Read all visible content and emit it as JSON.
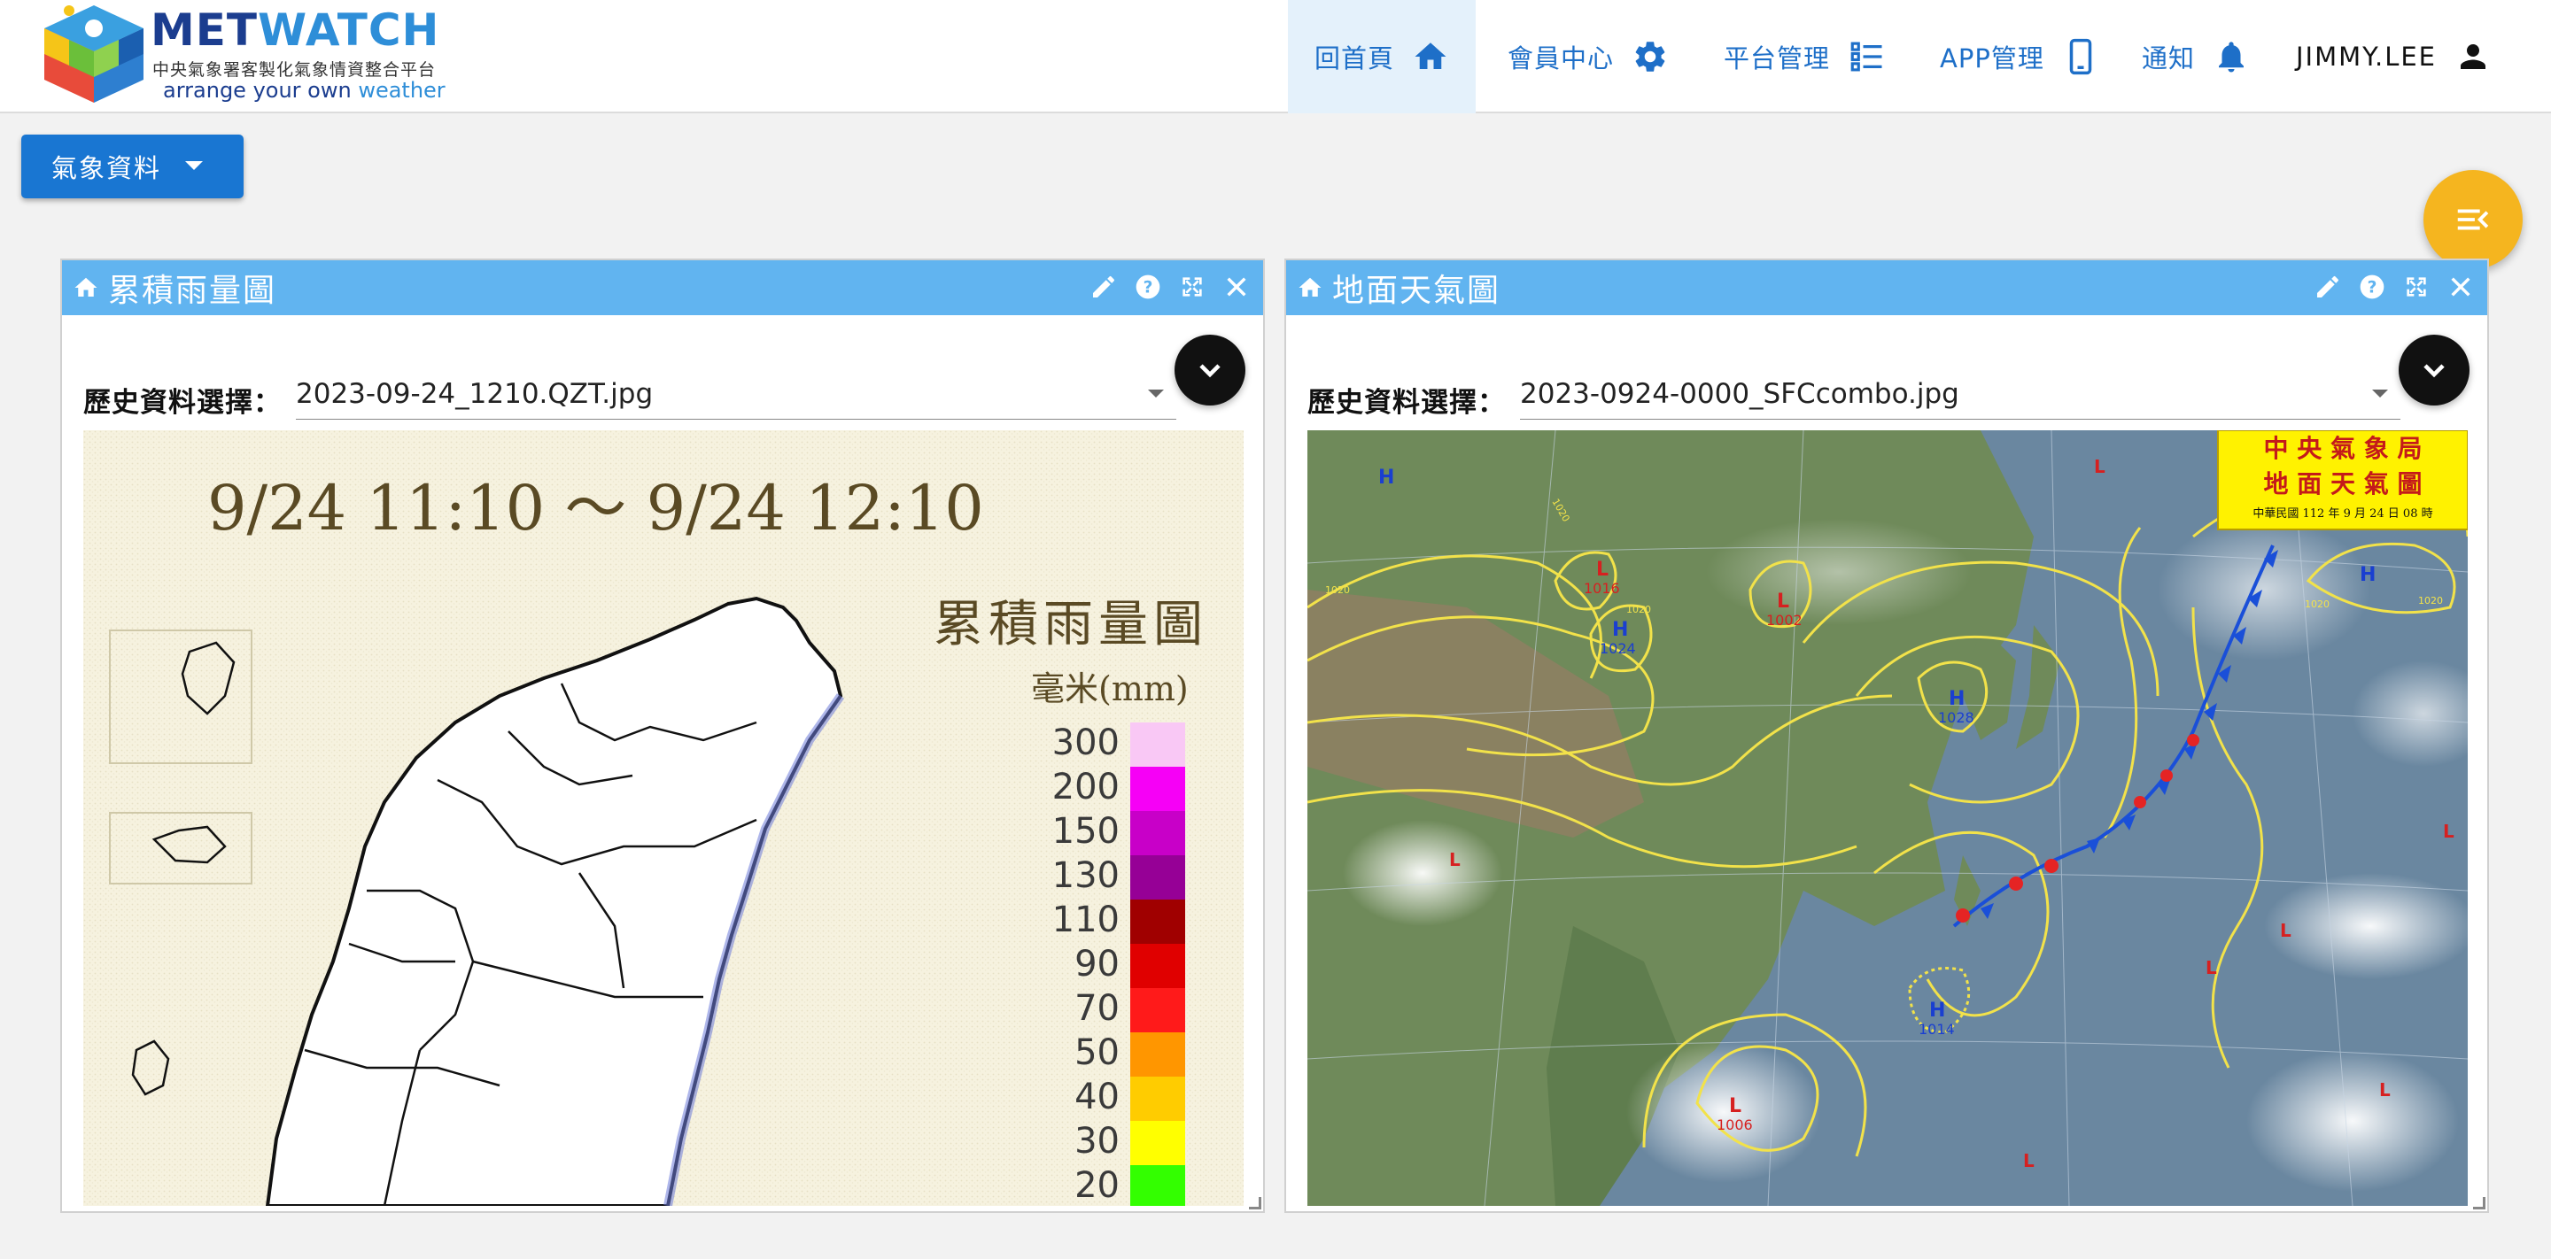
{
  "app": {
    "brand_met": "MET",
    "brand_watch": "WATCH",
    "subtitle": "中央氣象署客製化氣象情資整合平台",
    "tagline_start": "arrange your own ",
    "tagline_end": "weather"
  },
  "nav": {
    "home": "回首頁",
    "member": "會員中心",
    "platform": "平台管理",
    "app": "APP管理",
    "notify": "通知",
    "user": "JIMMY.LEE"
  },
  "toolbar": {
    "dropdown_label": "氣象資料"
  },
  "panels": {
    "left": {
      "title": "累積雨量圖",
      "select_label": "歷史資料選擇：",
      "select_value": "2023-09-24_1210.QZT.jpg",
      "map": {
        "time_range": "9/24 11:10 ～ 9/24 12:10",
        "heading": "累積雨量圖",
        "unit": "毫米(mm)",
        "legend": [
          {
            "value": "300",
            "color": "#f9c8f5"
          },
          {
            "value": "200",
            "color": "#f600f6"
          },
          {
            "value": "150",
            "color": "#c800c8"
          },
          {
            "value": "130",
            "color": "#960096"
          },
          {
            "value": "110",
            "color": "#a00000"
          },
          {
            "value": "90",
            "color": "#e00000"
          },
          {
            "value": "70",
            "color": "#ff1a1a"
          },
          {
            "value": "50",
            "color": "#ff9600"
          },
          {
            "value": "40",
            "color": "#ffcc00"
          },
          {
            "value": "30",
            "color": "#ffff00"
          },
          {
            "value": "20",
            "color": "#33ff00"
          }
        ]
      }
    },
    "right": {
      "title": "地面天氣圖",
      "select_label": "歷史資料選擇：",
      "select_value": "2023-0924-0000_SFCcombo.jpg",
      "map": {
        "stamp_line1": "中 央 氣 象 局",
        "stamp_line2": "地 面 天 氣 圖",
        "stamp_line3": "中華民國 112 年 9 月 24 日 08 時",
        "highs": [
          {
            "label": "H",
            "value": ""
          },
          {
            "label": "H",
            "value": "1024"
          },
          {
            "label": "H",
            "value": "1028"
          },
          {
            "label": "H",
            "value": "1014"
          },
          {
            "label": "H",
            "value": ""
          }
        ],
        "lows": [
          {
            "label": "L",
            "value": "1016"
          },
          {
            "label": "L",
            "value": "1002"
          },
          {
            "label": "L",
            "value": "1006"
          }
        ],
        "isobar_labels": [
          "1020",
          "1020",
          "1020",
          "1020",
          "1020"
        ]
      }
    }
  },
  "colors": {
    "brand_dark": "#1b3d8f",
    "brand_light": "#2e8ed8",
    "nav_text": "#1e6fc8",
    "panel_header": "#61b4f0",
    "button_blue": "#1976d2",
    "fab": "#f5b51f"
  },
  "icons": {
    "home": "home-icon",
    "member": "gear-icon",
    "platform": "list-icon",
    "app": "phone-icon",
    "notify": "bell-icon",
    "user": "user-icon"
  }
}
